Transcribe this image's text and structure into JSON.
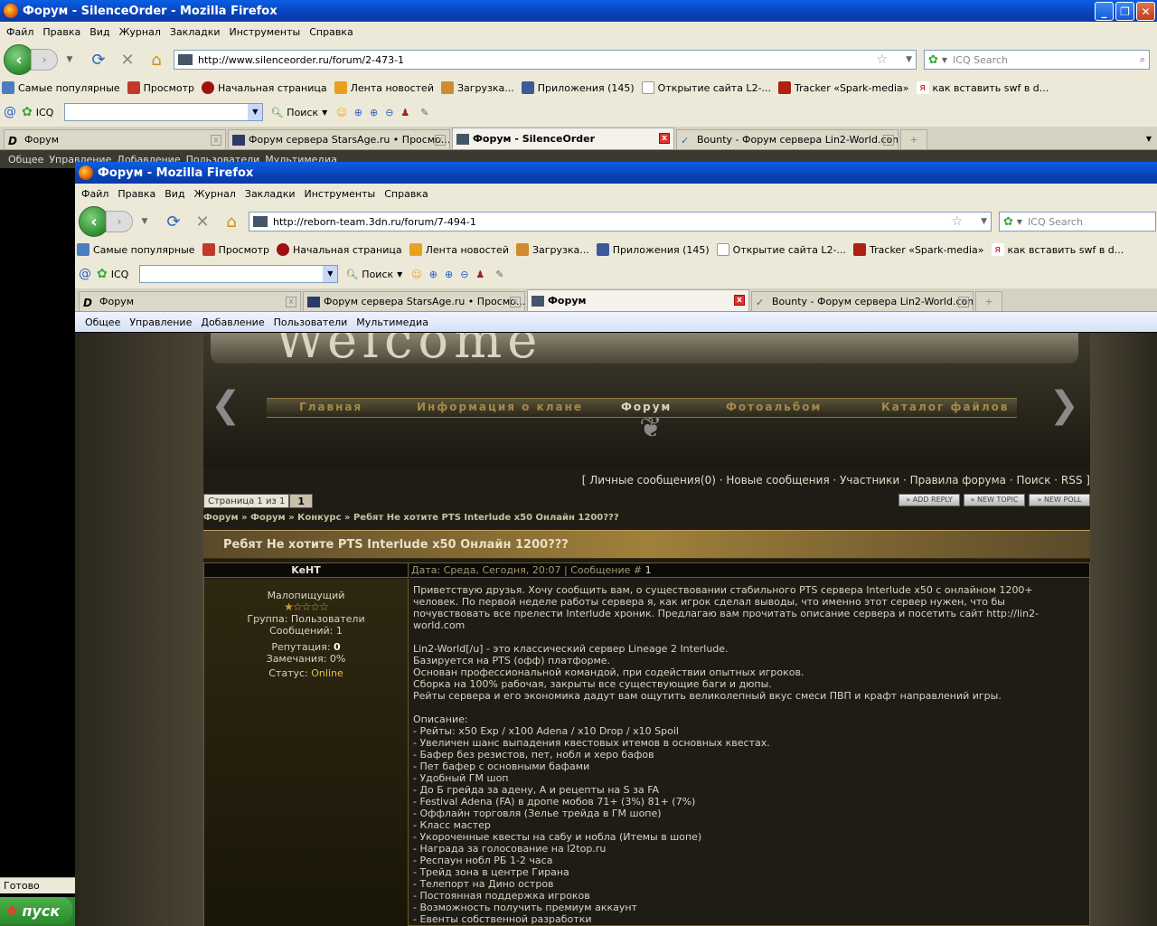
{
  "outer": {
    "title": "Форум - SilenceOrder - Mozilla Firefox",
    "menu": [
      "Файл",
      "Правка",
      "Вид",
      "Журнал",
      "Закладки",
      "Инструменты",
      "Справка"
    ],
    "url": "http://www.silenceorder.ru/forum/2-473-1",
    "search_placeholder": "ICQ Search",
    "tabs": [
      "Форум",
      "Форум сервера StarsAge.ru • Просмо...",
      "Форум - SilenceOrder",
      "Bounty - Форум сервера Lin2-World.com"
    ],
    "site_menu": [
      "Общее",
      "Управление",
      "Добавление",
      "Пользователи",
      "Мультимедиа"
    ],
    "status": "Готово"
  },
  "inner": {
    "title": "Форум - Mozilla Firefox",
    "menu": [
      "Файл",
      "Правка",
      "Вид",
      "Журнал",
      "Закладки",
      "Инструменты",
      "Справка"
    ],
    "url": "http://reborn-team.3dn.ru/forum/7-494-1",
    "search_placeholder": "ICQ Search",
    "tabs": [
      "Форум",
      "Форум сервера StarsAge.ru • Просмо...",
      "Форум",
      "Bounty - Форум сервера Lin2-World.com"
    ],
    "site_menu": [
      "Общее",
      "Управление",
      "Добавление",
      "Пользователи",
      "Мультимедиа"
    ]
  },
  "bookmarks": [
    "Самые популярные",
    "Просмотр",
    "Начальная страница",
    "Лента новостей",
    "Загрузка...",
    "Приложения (145)",
    "Открытие сайта L2-...",
    "Tracker «Spark-media»",
    "как вставить swf в d..."
  ],
  "icq": {
    "label": "ICQ",
    "search": "Поиск"
  },
  "start": "пуск",
  "forum": {
    "welcome": "Welcome",
    "nav": [
      "Главная",
      "Информация о клане",
      "Форум",
      "Фотоальбом",
      "Каталог файлов"
    ],
    "links": "[ Личные сообщения(0) · Новые сообщения · Участники · Правила форума · Поиск · RSS ]",
    "pages": "Страница 1 из 1",
    "page_num": "1",
    "buttons": [
      "ADD REPLY",
      "NEW TOPIC",
      "NEW POLL"
    ],
    "breadcrumb": [
      "Форум",
      "Форум",
      "Конкурс"
    ],
    "breadcrumb_tail": "Ребят Не хотите PTS Interlude x50 Онлайн 1200???",
    "topic_title": "Ребят Не хотите PTS Interlude x50 Онлайн 1200???",
    "author": "KeHT",
    "rank": "Малопищущий",
    "group": "Группа: Пользователи",
    "messages": "Сообщений: 1",
    "reputation_label": "Репутация:",
    "reputation": "0",
    "warnings": "Замечания: 0%",
    "status_label": "Статус:",
    "status": "Online",
    "post_meta": "Дата: Среда, Сегодня, 20:07 | Сообщение #",
    "post_num": "1",
    "post_lines": [
      "Приветствую друзья. Хочу сообщить вам, о существовании стабильного PTS сервера Interlude x50 с онлайном 1200+",
      "человек. По первой неделе работы сервера я, как игрок сделал выводы, что именно этот сервер нужен, что бы",
      "почувствовать все прелести Interlude хроник. Предлагаю вам прочитать описание сервера и посетить сайт http://lin2-",
      "world.com",
      "",
      "Lin2-World[/u] - это классический сервер Lineage 2 Interlude.",
      "Базируется на PTS (офф) платформе.",
      "Основан профессиональной командой, при содействии опытных игроков.",
      "Сборка на 100% рабочая, закрыты все существующие баги и дюпы.",
      "Рейты сервера и его экономика дадут вам ощутить великолепный вкус смеси ПВП и крафт направлений игры.",
      "",
      "Описание:",
      "- Рейты: x50 Exp / x100 Adena / x10 Drop / x10 Spoil",
      "- Увеличен шанс выпадения квестовых итемов в основных квестах.",
      "- Бафер без резистов, пет, нобл и херо бафов",
      "- Пет бафер с основными бафами",
      "- Удобный ГМ шоп",
      "- До Б грейда за адену, А и рецепты на S за FA",
      "- Festival Adena (FA) в дропе мобов 71+ (3%) 81+ (7%)",
      "- Оффлайн торговля (Зелье трейда в ГМ шопе)",
      "- Класс мастер",
      "- Укороченные квесты на сабу и нобла (Итемы в шопе)",
      "- Награда за голосование на l2top.ru",
      "- Респаун нобл РБ 1-2 часа",
      "- Трейд зона в центре Гирана",
      "- Телепорт на Дино остров",
      "- Постоянная поддержка игроков",
      "- Возможность получить премиум аккаунт",
      "- Евенты собственной разработки"
    ]
  }
}
